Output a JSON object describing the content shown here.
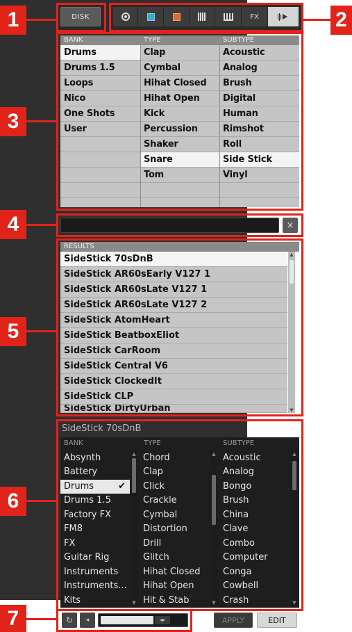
{
  "callouts": [
    "1",
    "2",
    "3",
    "4",
    "5",
    "6",
    "7"
  ],
  "topbar": {
    "disk_label": "DISK",
    "type_buttons": [
      {
        "icon": "project-icon",
        "label": "◎"
      },
      {
        "icon": "group-icon",
        "color": "#2bb6c8"
      },
      {
        "icon": "sound-icon",
        "color": "#e06a2e"
      },
      {
        "icon": "pattern-icon",
        "label": "▦"
      },
      {
        "icon": "instrument-icon",
        "label": "Ⅲ"
      },
      {
        "icon": "fx-icon",
        "label": "FX"
      },
      {
        "icon": "sample-icon",
        "label": "⊪▸"
      }
    ]
  },
  "attr_filter": {
    "headers": [
      "BANK",
      "TYPE",
      "SUBTYPE"
    ],
    "bank": [
      "Drums",
      "Drums 1.5",
      "Loops",
      "Nico",
      "One Shots",
      "User"
    ],
    "type": [
      "Clap",
      "Cymbal",
      "Hihat Closed",
      "Hihat Open",
      "Kick",
      "Percussion",
      "Shaker",
      "Snare",
      "Tom"
    ],
    "subtype": [
      "Acoustic",
      "Analog",
      "Brush",
      "Digital",
      "Human",
      "Rimshot",
      "Roll",
      "Side Stick",
      "Vinyl"
    ],
    "selected": {
      "bank": "Drums",
      "type": "Snare",
      "subtype": "Side Stick"
    }
  },
  "search": {
    "placeholder": "",
    "clear_label": "×"
  },
  "results": {
    "header": "RESULTS",
    "items": [
      "SideStick 70sDnB",
      "SideStick AR60sEarly V127 1",
      "SideStick AR60sLate V127 1",
      "SideStick AR60sLate V127 2",
      "SideStick AtomHeart",
      "SideStick BeatboxEliot",
      "SideStick CarRoom",
      "SideStick Central V6",
      "SideStick ClockedIt",
      "SideStick CLP",
      "SideStick DirtyUrban"
    ],
    "selected_index": 0
  },
  "attr_editor": {
    "title": "SideStick 70sDnB",
    "headers": [
      "BANK",
      "TYPE",
      "SUBTYPE"
    ],
    "bank": [
      "Absynth",
      "Battery",
      "Drums",
      "Drums 1.5",
      "Factory FX",
      "FM8",
      "FX",
      "Guitar Rig",
      "Instruments",
      "Instruments...",
      "Kits"
    ],
    "type": [
      "Chord",
      "Clap",
      "Click",
      "Crackle",
      "Cymbal",
      "Distortion",
      "Drill",
      "Glitch",
      "Hihat Closed",
      "Hihat Open",
      "Hit & Stab"
    ],
    "subtype": [
      "Acoustic",
      "Analog",
      "Bongo",
      "Brush",
      "China",
      "Clave",
      "Combo",
      "Computer",
      "Conga",
      "Cowbell",
      "Crash"
    ],
    "selected_bank": "Drums",
    "check_mark": "✔"
  },
  "prehear": {
    "play_icon": "↻",
    "volume_icon": "◂",
    "slider_arrows": "◂▸"
  },
  "buttons": {
    "apply": "APPLY",
    "edit": "EDIT"
  }
}
